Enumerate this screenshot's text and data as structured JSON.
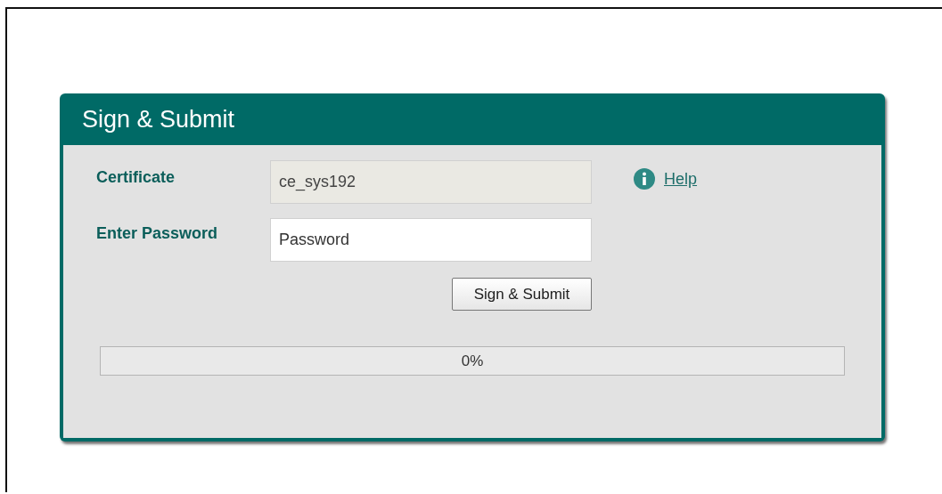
{
  "dialog": {
    "title": "Sign & Submit"
  },
  "fields": [
    {
      "label": "Certificate",
      "value": "ce_sys192",
      "disabled": true
    },
    {
      "label": "Enter Password",
      "placeholder": "Password",
      "disabled": false
    }
  ],
  "help_link": "Help",
  "submit_button": "Sign & Submit",
  "progress": {
    "level": 0,
    "reading": "0%"
  }
}
